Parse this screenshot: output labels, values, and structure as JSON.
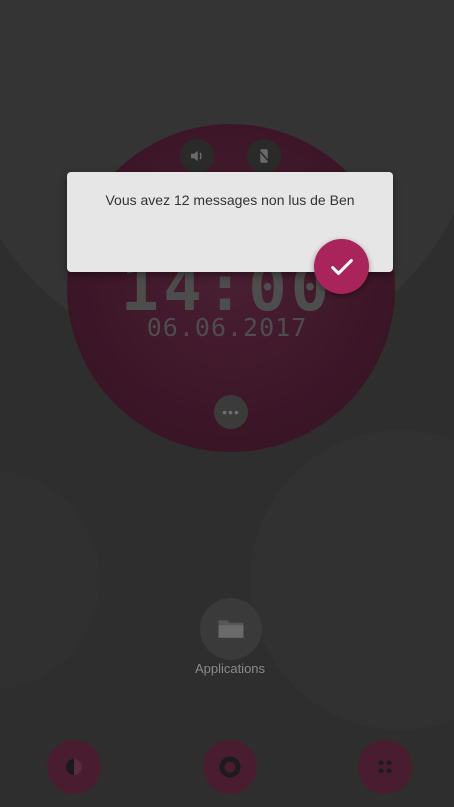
{
  "lockscreen": {
    "time": "14:00",
    "date": "06.06.2017",
    "status_icons": [
      "speaker-icon",
      "no-disturb-icon"
    ],
    "more_label": "•••"
  },
  "notification": {
    "message": "Vous avez 12 messages non lus de Ben",
    "confirm_icon": "check-icon"
  },
  "apps": {
    "label": "Applications",
    "icon": "folder-icon"
  },
  "dock": {
    "items": [
      "half-circle-icon",
      "home-ring-icon",
      "grid-dots-icon"
    ]
  },
  "colors": {
    "accent": "#a8245a",
    "circle": "#3a1526",
    "background": "#2e2e2e"
  }
}
